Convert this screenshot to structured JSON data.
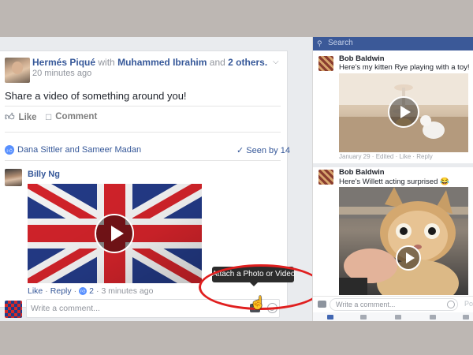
{
  "post": {
    "author": "Hermés Piqué",
    "with_word": "with",
    "tagged": "Muhammed Ibrahim",
    "and_word": "and",
    "others": "2 others.",
    "time": "20 minutes ago",
    "text": "Share a video of something around you!",
    "actions": {
      "like": "Like",
      "comment": "Comment"
    },
    "reactions": "Dana Sittler and Sameer Madan",
    "seen": "Seen by 14"
  },
  "comment": {
    "author": "Billy Ng",
    "like": "Like",
    "reply": "Reply",
    "like_count": "2",
    "time": "3 minutes ago",
    "separator": "·"
  },
  "composer": {
    "placeholder": "Write a comment...",
    "tooltip": "Attach a Photo or Video"
  },
  "right_panel": {
    "search_placeholder": "Search",
    "posts": [
      {
        "author": "Bob Baldwin",
        "text": "Here's my kitten Rye playing with a toy!",
        "meta": "January 29 · Edited · Like · Reply"
      },
      {
        "author": "Bob Baldwin",
        "text": "Here's Willett acting surprised 😂"
      }
    ],
    "comment_placeholder": "Write a comment...",
    "post_label": "Po"
  }
}
